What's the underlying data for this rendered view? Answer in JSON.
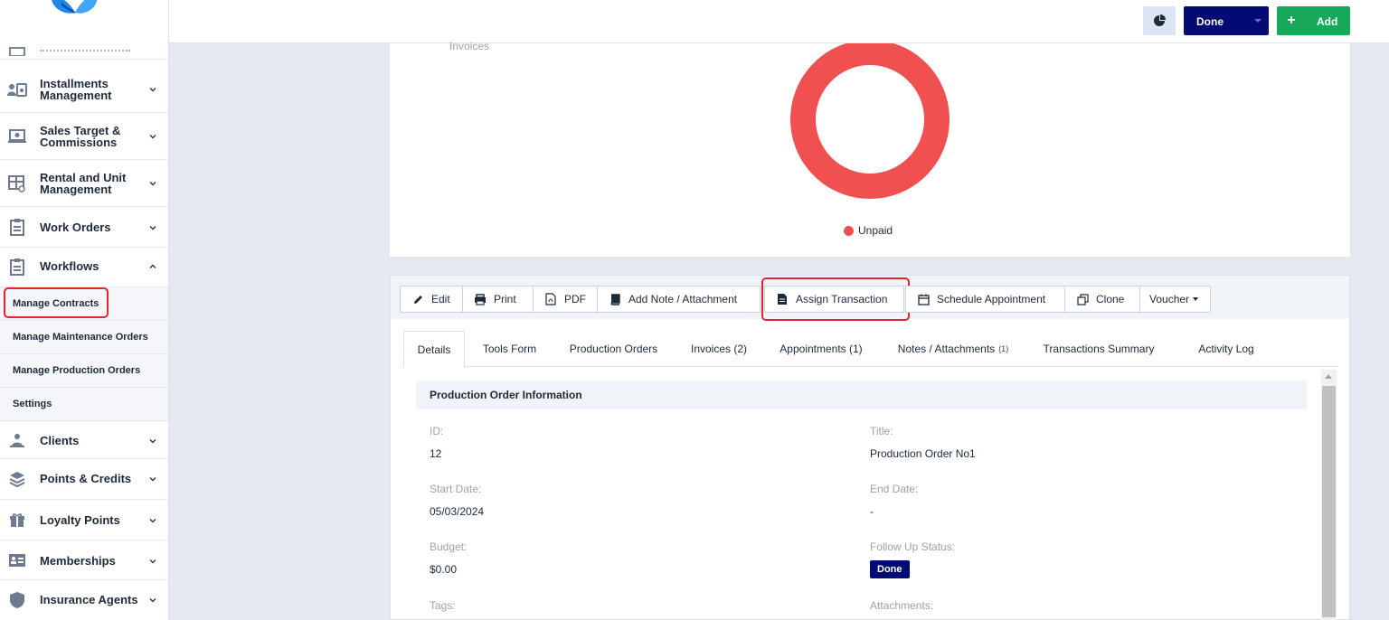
{
  "sidebar": {
    "items": [
      {
        "label": "Installments\nManagement",
        "icon": "installments-icon",
        "expanded": false
      },
      {
        "label": "Sales Target &\nCommissions",
        "icon": "commissions-icon",
        "expanded": false
      },
      {
        "label": "Rental and Unit\nManagement",
        "icon": "rental-icon",
        "expanded": false
      },
      {
        "label": "Work Orders",
        "icon": "clipboard-icon",
        "expanded": false
      },
      {
        "label": "Workflows",
        "icon": "clipboard-icon",
        "expanded": true
      },
      {
        "label": "Clients",
        "icon": "clients-icon",
        "expanded": false
      },
      {
        "label": "Points & Credits",
        "icon": "layers-icon",
        "expanded": false
      },
      {
        "label": "Loyalty Points",
        "icon": "gift-icon",
        "expanded": false
      },
      {
        "label": "Memberships",
        "icon": "membership-card-icon",
        "expanded": false
      },
      {
        "label": "Insurance Agents",
        "icon": "shield-icon",
        "expanded": false
      }
    ],
    "workflows_sub": [
      {
        "label": "Manage Contracts",
        "highlighted": true
      },
      {
        "label": "Manage Maintenance Orders"
      },
      {
        "label": "Manage Production Orders"
      },
      {
        "label": "Settings"
      }
    ]
  },
  "topbar": {
    "status_label": "Done",
    "add_label": "Add",
    "colors": {
      "done": "#030a73",
      "add": "#17a85b"
    }
  },
  "chart_data": {
    "type": "pie",
    "title": "Invoices",
    "categories": [
      "Unpaid"
    ],
    "values": [
      100
    ],
    "colors": [
      "#f05050"
    ],
    "donut": true,
    "legend": "bottom"
  },
  "toolbar": {
    "edit": "Edit",
    "print": "Print",
    "pdf": "PDF",
    "add_note": "Add Note / Attachment",
    "assign_transaction": "Assign Transaction",
    "schedule_appointment": "Schedule Appointment",
    "clone": "Clone",
    "voucher": "Voucher"
  },
  "tabs": [
    {
      "label": "Details",
      "active": true
    },
    {
      "label": "Tools Form"
    },
    {
      "label": "Production Orders"
    },
    {
      "label": "Invoices (2)"
    },
    {
      "label": "Appointments (1)"
    },
    {
      "label": "Notes / Attachments",
      "count": "(1)"
    },
    {
      "label": "Transactions Summary"
    },
    {
      "label": "Activity Log"
    }
  ],
  "details": {
    "section_title": "Production Order Information",
    "id_label": "ID:",
    "id_value": "12",
    "title_label": "Title:",
    "title_value": "Production Order No1",
    "start_label": "Start Date:",
    "start_value": "05/03/2024",
    "end_label": "End Date:",
    "end_value": "-",
    "budget_label": "Budget:",
    "budget_value": "$0.00",
    "follow_label": "Follow Up Status:",
    "follow_value": "Done",
    "tags_label": "Tags:",
    "attachments_label": "Attachments:"
  }
}
